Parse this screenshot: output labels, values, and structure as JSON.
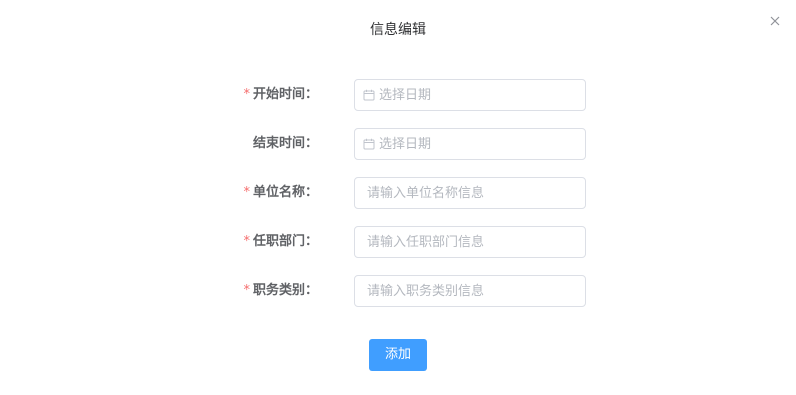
{
  "dialog": {
    "title": "信息编辑",
    "close_icon": "close-icon"
  },
  "form": {
    "fields": [
      {
        "label": "开始时间：",
        "required": true,
        "placeholder": "选择日期",
        "value": "",
        "icon": "calendar-icon"
      },
      {
        "label": "结束时间：",
        "required": false,
        "placeholder": "选择日期",
        "value": "",
        "icon": "calendar-icon"
      },
      {
        "label": "单位名称：",
        "required": true,
        "placeholder": "请输入单位名称信息",
        "value": ""
      },
      {
        "label": "任职部门：",
        "required": true,
        "placeholder": "请输入任职部门信息",
        "value": ""
      },
      {
        "label": "职务类别：",
        "required": true,
        "placeholder": "请输入职务类别信息",
        "value": ""
      }
    ],
    "required_mark": "*"
  },
  "actions": {
    "add_label": "添加"
  },
  "colors": {
    "primary": "#409eff",
    "required": "#f56c6c",
    "border": "#dcdfe6",
    "placeholder": "#b4b8bf"
  }
}
